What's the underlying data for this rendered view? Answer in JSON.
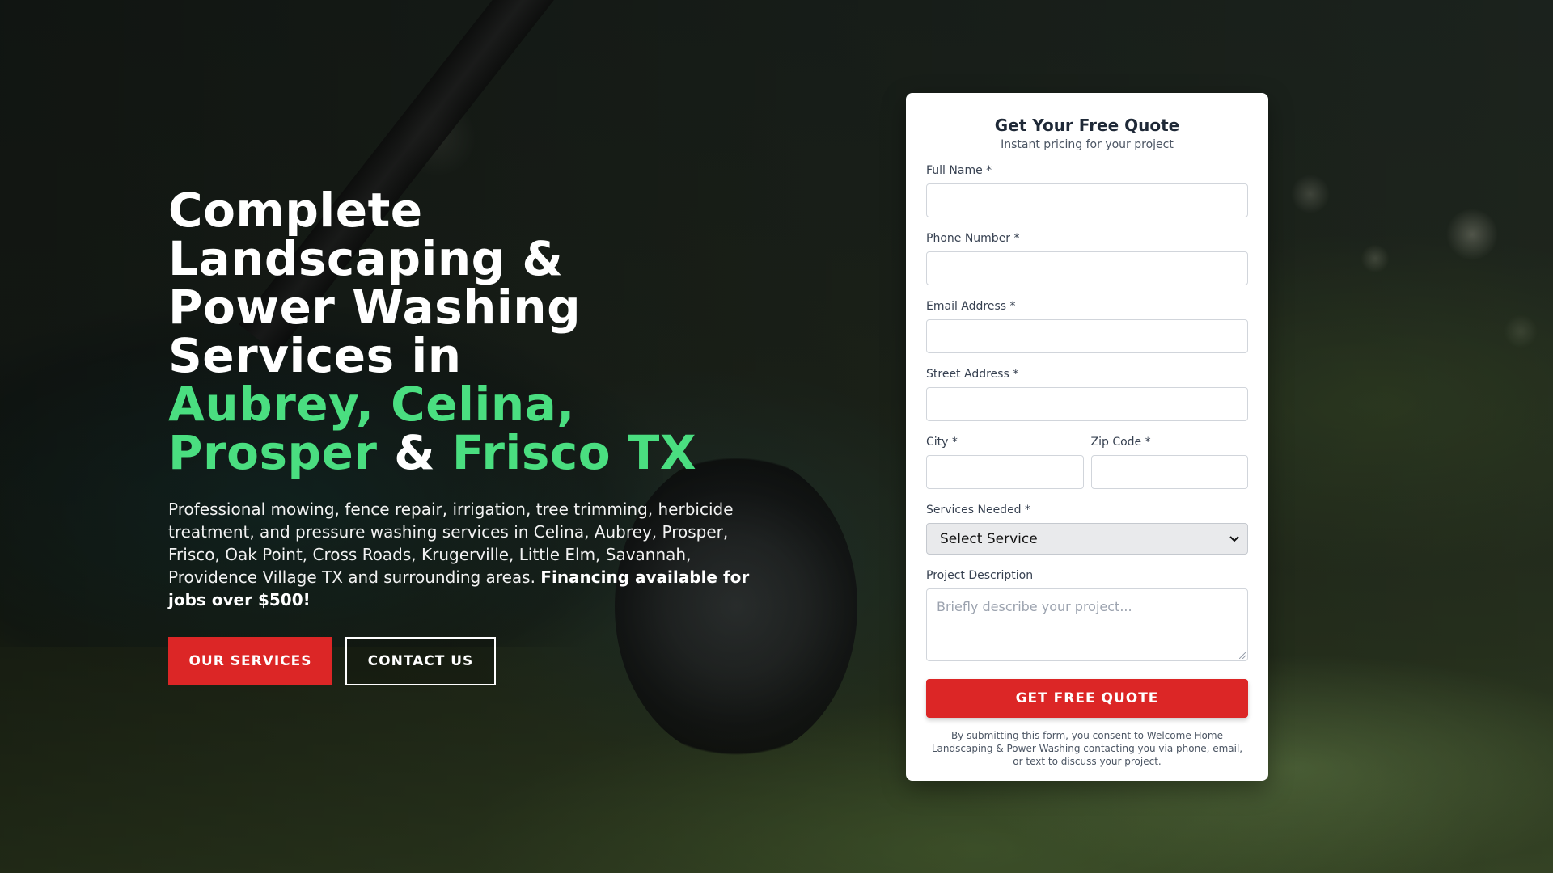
{
  "hero": {
    "title_lines": [
      "Complete",
      "Landscaping &",
      "Power Washing",
      "Services in"
    ],
    "title_green_1": "Aubrey, Celina,",
    "title_green_2": "Prosper",
    "title_amp": " & ",
    "title_green_3": "Frisco TX",
    "description": "Professional mowing, fence repair, irrigation, tree trimming, herbicide treatment, and pressure washing services in Celina, Aubrey, Prosper, Frisco, Oak Point, Cross Roads, Krugerville, Little Elm, Savannah, Providence Village TX and surrounding areas.",
    "description_bold": "Financing available for jobs over $500!",
    "buttons": {
      "services": "OUR SERVICES",
      "contact": "CONTACT US"
    }
  },
  "quote_form": {
    "title": "Get Your Free Quote",
    "subtitle": "Instant pricing for your project",
    "fields": {
      "full_name": "Full Name *",
      "phone": "Phone Number *",
      "email": "Email Address *",
      "street": "Street Address *",
      "city": "City *",
      "zip": "Zip Code *",
      "services": "Services Needed *",
      "description": "Project Description"
    },
    "services_selected": "Select Service",
    "description_placeholder": "Briefly describe your project...",
    "submit": "GET FREE QUOTE",
    "consent": "By submitting this form, you consent to Welcome Home Landscaping & Power Washing contacting you via phone, email, or text to discuss your project."
  },
  "colors": {
    "accent_red": "#dc2626",
    "accent_green": "#4ade80"
  },
  "icons": {
    "select_chevron": "chevron-down-icon"
  }
}
